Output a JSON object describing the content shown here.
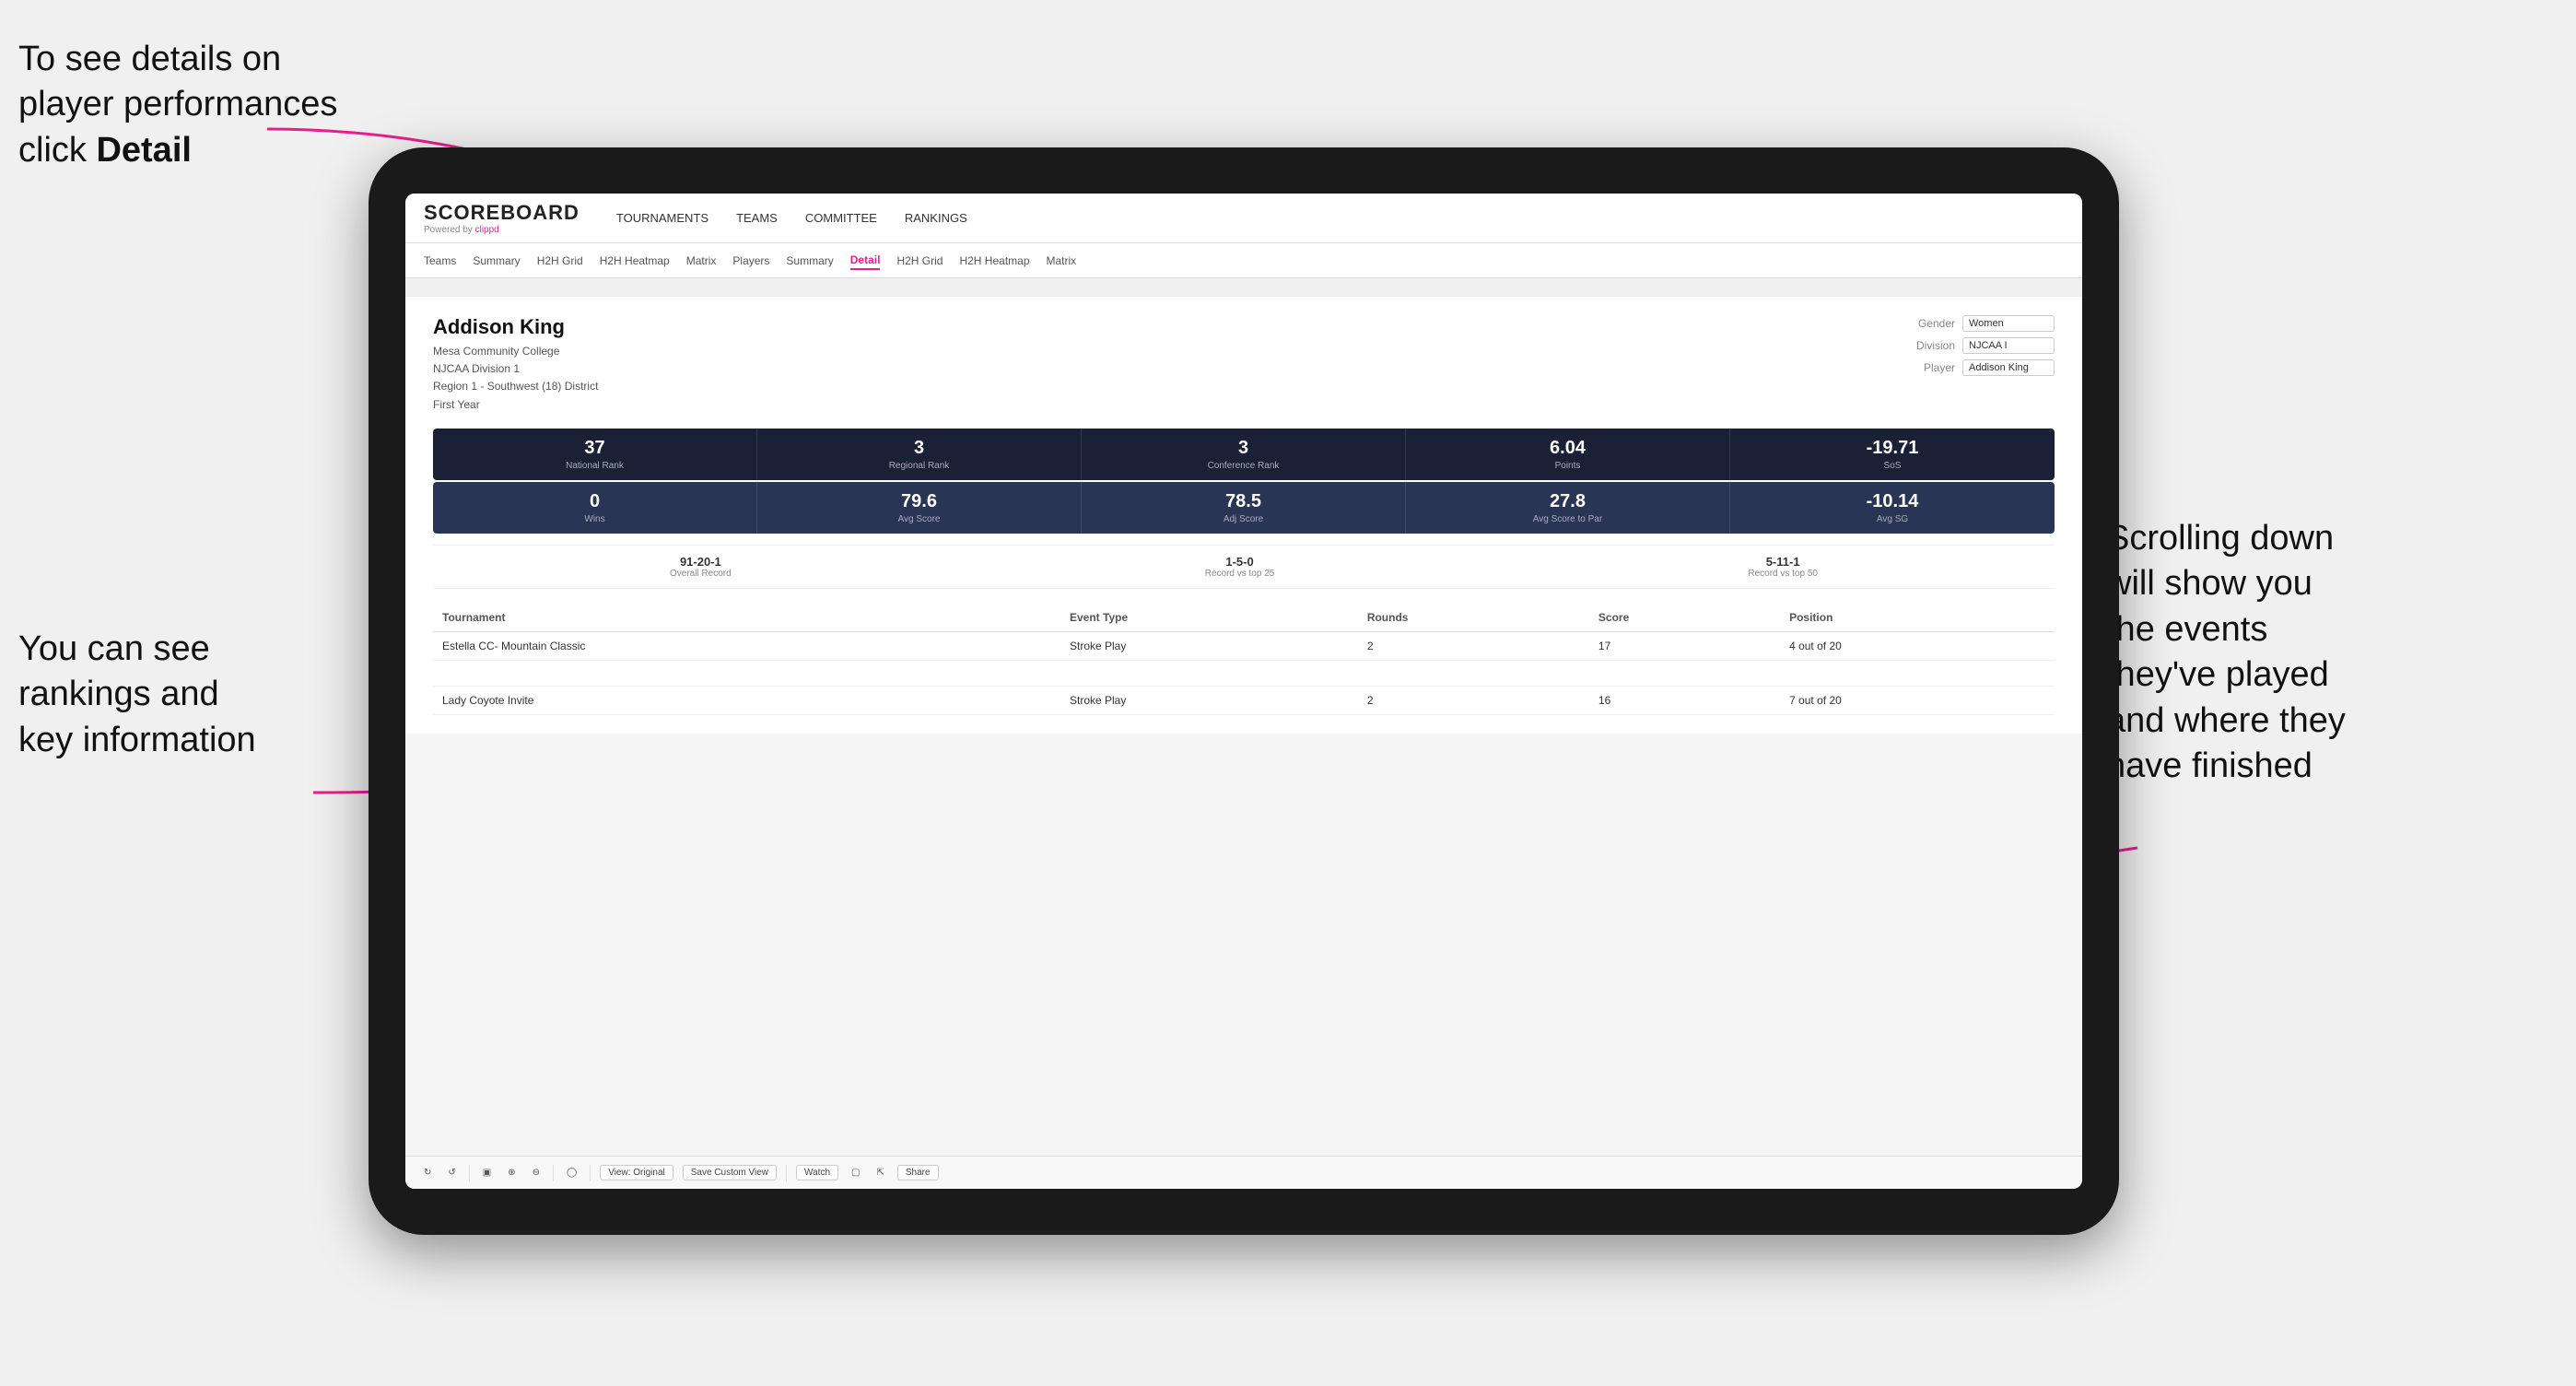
{
  "annotations": {
    "topleft": "To see details on player performances click ",
    "topleft_bold": "Detail",
    "bottomleft_line1": "You can see",
    "bottomleft_line2": "rankings and",
    "bottomleft_line3": "key information",
    "bottomright_line1": "Scrolling down",
    "bottomright_line2": "will show you",
    "bottomright_line3": "the events",
    "bottomright_line4": "they've played",
    "bottomright_line5": "and where they",
    "bottomright_line6": "have finished"
  },
  "nav": {
    "logo": "SCOREBOARD",
    "powered_by": "Powered by ",
    "clippd": "clippd",
    "items": [
      "TOURNAMENTS",
      "TEAMS",
      "COMMITTEE",
      "RANKINGS"
    ]
  },
  "subnav": {
    "items": [
      "Teams",
      "Summary",
      "H2H Grid",
      "H2H Heatmap",
      "Matrix",
      "Players",
      "Summary",
      "Detail",
      "H2H Grid",
      "H2H Heatmap",
      "Matrix"
    ]
  },
  "player": {
    "name": "Addison King",
    "college": "Mesa Community College",
    "division": "NJCAA Division 1",
    "region": "Region 1 - Southwest (18) District",
    "year": "First Year"
  },
  "controls": {
    "gender_label": "Gender",
    "gender_value": "Women",
    "division_label": "Division",
    "division_value": "NJCAA I",
    "player_label": "Player",
    "player_value": "Addison King"
  },
  "stats_row1": [
    {
      "value": "37",
      "label": "National Rank"
    },
    {
      "value": "3",
      "label": "Regional Rank"
    },
    {
      "value": "3",
      "label": "Conference Rank"
    },
    {
      "value": "6.04",
      "label": "Points"
    },
    {
      "value": "-19.71",
      "label": "SoS"
    }
  ],
  "stats_row2": [
    {
      "value": "0",
      "label": "Wins"
    },
    {
      "value": "79.6",
      "label": "Avg Score"
    },
    {
      "value": "78.5",
      "label": "Adj Score"
    },
    {
      "value": "27.8",
      "label": "Avg Score to Par"
    },
    {
      "value": "-10.14",
      "label": "Avg SG"
    }
  ],
  "records": [
    {
      "value": "91-20-1",
      "label": "Overall Record"
    },
    {
      "value": "1-5-0",
      "label": "Record vs top 25"
    },
    {
      "value": "5-11-1",
      "label": "Record vs top 50"
    }
  ],
  "tournament_table": {
    "headers": [
      "Tournament",
      "Event Type",
      "Rounds",
      "Score",
      "Position"
    ],
    "rows": [
      {
        "tournament": "Estella CC- Mountain Classic",
        "event_type": "Stroke Play",
        "rounds": "2",
        "score": "17",
        "position": "4 out of 20"
      },
      {
        "tournament": "",
        "event_type": "",
        "rounds": "",
        "score": "",
        "position": ""
      },
      {
        "tournament": "Lady Coyote Invite",
        "event_type": "Stroke Play",
        "rounds": "2",
        "score": "16",
        "position": "7 out of 20"
      }
    ]
  },
  "toolbar": {
    "view_original": "View: Original",
    "save_custom": "Save Custom View",
    "watch": "Watch",
    "share": "Share"
  }
}
